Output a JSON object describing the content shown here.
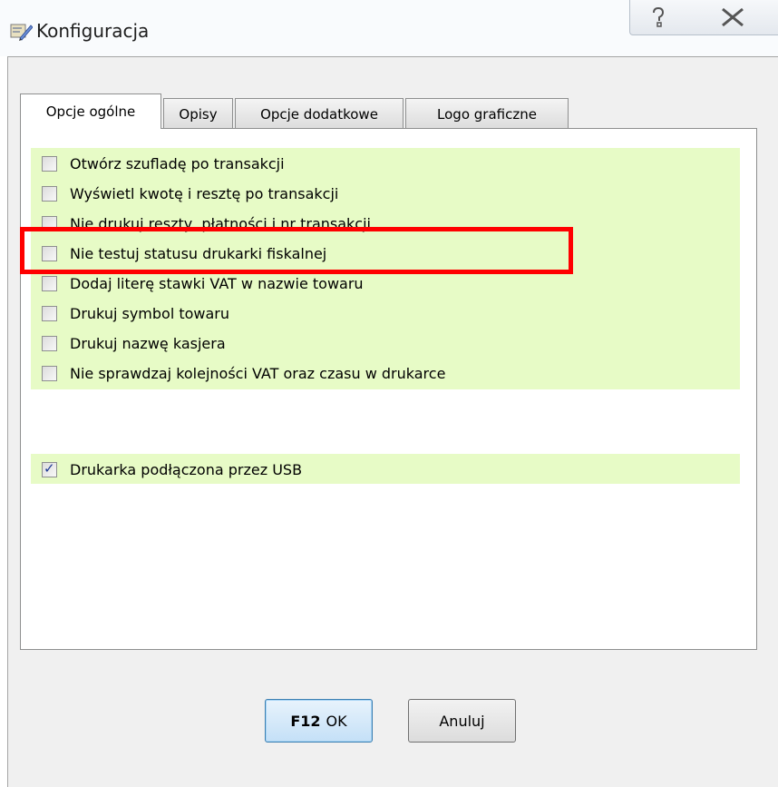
{
  "window": {
    "title": "Konfiguracja",
    "help_icon": "help-question-icon",
    "close_icon": "close-x-icon"
  },
  "tabs": [
    {
      "label": "Opcje ogólne",
      "active": true
    },
    {
      "label": "Opisy",
      "active": false
    },
    {
      "label": "Opcje dodatkowe",
      "active": false
    },
    {
      "label": "Logo graficzne",
      "active": false
    }
  ],
  "options": [
    {
      "label": "Otwórz szufladę po transakcji",
      "checked": false
    },
    {
      "label": "Wyświetl kwotę i resztę po transakcji",
      "checked": false
    },
    {
      "label": "Nie drukuj reszty, płatności i nr transakcji",
      "checked": false
    },
    {
      "label": "Nie testuj statusu drukarki fiskalnej",
      "checked": false
    },
    {
      "label": "Dodaj literę stawki VAT w nazwie towaru",
      "checked": false
    },
    {
      "label": "Drukuj symbol towaru",
      "checked": false
    },
    {
      "label": "Drukuj nazwę kasjera",
      "checked": false
    },
    {
      "label": "Nie sprawdzaj kolejności VAT oraz czasu w drukarce",
      "checked": false
    }
  ],
  "usb_option": {
    "label": "Drukarka podłączona przez USB",
    "checked": true
  },
  "buttons": {
    "ok_key": "F12",
    "ok_label": "OK",
    "cancel_label": "Anuluj"
  },
  "colors": {
    "option_bg": "#e7fbc6",
    "highlight": "#ff0000"
  }
}
